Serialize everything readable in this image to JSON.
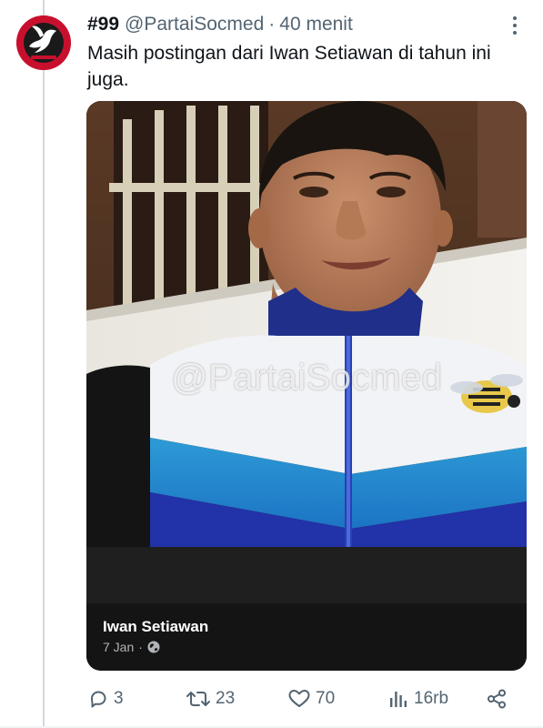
{
  "tweet": {
    "display_name": "#99",
    "handle": "@PartaiSocmed",
    "separator": "·",
    "time_ago": "40 menit",
    "text": "Masih postingan dari Iwan Setiawan di tahun ini juga."
  },
  "media": {
    "watermark": "@PartaiSocmed",
    "profile_name": "Iwan Setiawan",
    "date": "7 Jan",
    "separator": "·",
    "globe_icon": "globe-icon"
  },
  "actions": {
    "replies": "3",
    "retweets": "23",
    "likes": "70",
    "views": "16rb"
  },
  "colors": {
    "text_primary": "#0f1419",
    "text_secondary": "#536471",
    "avatar_bg": "#c8102e",
    "card_footer": "#141414"
  }
}
